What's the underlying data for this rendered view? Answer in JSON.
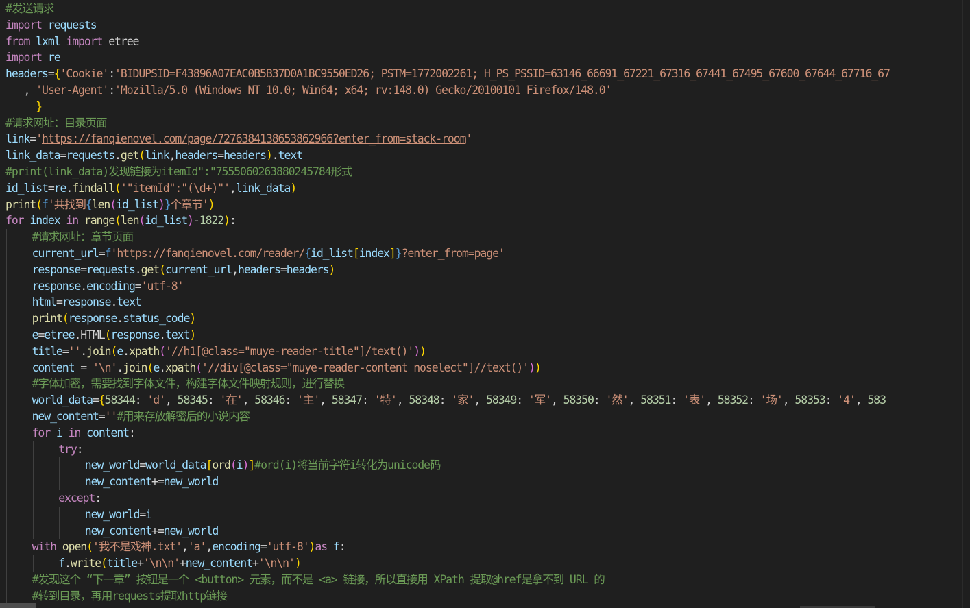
{
  "code_lines": [
    {
      "indent": 0,
      "tokens": [
        {
          "t": "#发送请求",
          "c": "c"
        }
      ]
    },
    {
      "indent": 0,
      "tokens": [
        {
          "t": "import",
          "c": "kc"
        },
        {
          "t": " "
        },
        {
          "t": "requests",
          "c": "v"
        }
      ]
    },
    {
      "indent": 0,
      "tokens": [
        {
          "t": "from",
          "c": "kc"
        },
        {
          "t": " "
        },
        {
          "t": "lxml",
          "c": "v"
        },
        {
          "t": " "
        },
        {
          "t": "import",
          "c": "kc"
        },
        {
          "t": " etree"
        }
      ]
    },
    {
      "indent": 0,
      "tokens": [
        {
          "t": "import",
          "c": "kc"
        },
        {
          "t": " "
        },
        {
          "t": "re",
          "c": "v"
        }
      ]
    },
    {
      "indent": 0,
      "tokens": [
        {
          "t": "headers",
          "c": "v"
        },
        {
          "t": "="
        },
        {
          "t": "{",
          "c": "c1"
        },
        {
          "t": "'Cookie'",
          "c": "s"
        },
        {
          "t": ":"
        },
        {
          "t": "'BIDUPSID=F43896A07EAC0B5B37D0A1BC9550ED26; PSTM=1772002261; H_PS_PSSID=63146_66691_67221_67316_67441_67495_67600_67644_67716_67",
          "c": "s"
        }
      ]
    },
    {
      "indent": 0,
      "tokens": [
        {
          "t": "   , "
        },
        {
          "t": "'User-Agent'",
          "c": "s"
        },
        {
          "t": ":"
        },
        {
          "t": "'Mozilla/5.0 (Windows NT 10.0; Win64; x64; rv:148.0) Gecko/20100101 Firefox/148.0'",
          "c": "s"
        }
      ]
    },
    {
      "indent": 0,
      "tokens": [
        {
          "t": "     "
        },
        {
          "t": "}",
          "c": "c1"
        }
      ]
    },
    {
      "indent": 0,
      "tokens": [
        {
          "t": "#请求网址：目录页面",
          "c": "c"
        }
      ]
    },
    {
      "indent": 0,
      "tokens": [
        {
          "t": "link",
          "c": "v"
        },
        {
          "t": "="
        },
        {
          "t": "'",
          "c": "s"
        },
        {
          "t": "https://fanqienovel.com/page/7276384138653862966?enter_from=stack-room",
          "c": "s u"
        },
        {
          "t": "'",
          "c": "s"
        }
      ]
    },
    {
      "indent": 0,
      "tokens": [
        {
          "t": "link_data",
          "c": "v"
        },
        {
          "t": "="
        },
        {
          "t": "requests",
          "c": "v"
        },
        {
          "t": "."
        },
        {
          "t": "get",
          "c": "f"
        },
        {
          "t": "(",
          "c": "c1"
        },
        {
          "t": "link",
          "c": "v"
        },
        {
          "t": ","
        },
        {
          "t": "headers",
          "c": "v"
        },
        {
          "t": "="
        },
        {
          "t": "headers",
          "c": "v"
        },
        {
          "t": ")",
          "c": "c1"
        },
        {
          "t": "."
        },
        {
          "t": "text",
          "c": "v"
        }
      ]
    },
    {
      "indent": 0,
      "tokens": [
        {
          "t": "#print(link_data)发现链接为itemId\":\"7555060263880245784形式",
          "c": "c"
        }
      ]
    },
    {
      "indent": 0,
      "tokens": [
        {
          "t": "id_list",
          "c": "v"
        },
        {
          "t": "="
        },
        {
          "t": "re",
          "c": "v"
        },
        {
          "t": "."
        },
        {
          "t": "findall",
          "c": "f"
        },
        {
          "t": "(",
          "c": "c1"
        },
        {
          "t": "'\"itemId\":\"(\\d+)\"'",
          "c": "s"
        },
        {
          "t": ","
        },
        {
          "t": "link_data",
          "c": "v"
        },
        {
          "t": ")",
          "c": "c1"
        }
      ]
    },
    {
      "indent": 0,
      "tokens": [
        {
          "t": "print",
          "c": "f"
        },
        {
          "t": "(",
          "c": "c1"
        },
        {
          "t": "f",
          "c": "k"
        },
        {
          "t": "'共找到",
          "c": "s"
        },
        {
          "t": "{",
          "c": "k"
        },
        {
          "t": "len",
          "c": "f"
        },
        {
          "t": "(",
          "c": "c2"
        },
        {
          "t": "id_list",
          "c": "v"
        },
        {
          "t": ")",
          "c": "c2"
        },
        {
          "t": "}",
          "c": "k"
        },
        {
          "t": "个章节'",
          "c": "s"
        },
        {
          "t": ")",
          "c": "c1"
        }
      ]
    },
    {
      "indent": 0,
      "tokens": [
        {
          "t": "for",
          "c": "kc"
        },
        {
          "t": " "
        },
        {
          "t": "index",
          "c": "v"
        },
        {
          "t": " "
        },
        {
          "t": "in",
          "c": "kc"
        },
        {
          "t": " "
        },
        {
          "t": "range",
          "c": "f"
        },
        {
          "t": "(",
          "c": "c1"
        },
        {
          "t": "len",
          "c": "f"
        },
        {
          "t": "(",
          "c": "c2"
        },
        {
          "t": "id_list",
          "c": "v"
        },
        {
          "t": ")",
          "c": "c2"
        },
        {
          "t": "-"
        },
        {
          "t": "1822",
          "c": "n"
        },
        {
          "t": ")",
          "c": "c1"
        },
        {
          "t": ":"
        }
      ]
    },
    {
      "indent": 1,
      "tokens": [
        {
          "t": "#请求网址：章节页面",
          "c": "c"
        }
      ]
    },
    {
      "indent": 1,
      "tokens": [
        {
          "t": "current_url",
          "c": "v"
        },
        {
          "t": "="
        },
        {
          "t": "f",
          "c": "k"
        },
        {
          "t": "'",
          "c": "s"
        },
        {
          "t": "https://fanqienovel.com/reader/",
          "c": "s u"
        },
        {
          "t": "{",
          "c": "k u"
        },
        {
          "t": "id_list",
          "c": "v u"
        },
        {
          "t": "[",
          "c": "c1 u"
        },
        {
          "t": "index",
          "c": "v u"
        },
        {
          "t": "]",
          "c": "c1 u"
        },
        {
          "t": "}",
          "c": "k u"
        },
        {
          "t": "?enter_from=page",
          "c": "s u"
        },
        {
          "t": "'",
          "c": "s"
        }
      ]
    },
    {
      "indent": 1,
      "tokens": [
        {
          "t": "response",
          "c": "v"
        },
        {
          "t": "="
        },
        {
          "t": "requests",
          "c": "v"
        },
        {
          "t": "."
        },
        {
          "t": "get",
          "c": "f"
        },
        {
          "t": "(",
          "c": "c1"
        },
        {
          "t": "current_url",
          "c": "v"
        },
        {
          "t": ","
        },
        {
          "t": "headers",
          "c": "v"
        },
        {
          "t": "="
        },
        {
          "t": "headers",
          "c": "v"
        },
        {
          "t": ")",
          "c": "c1"
        }
      ]
    },
    {
      "indent": 1,
      "tokens": [
        {
          "t": "response",
          "c": "v"
        },
        {
          "t": "."
        },
        {
          "t": "encoding",
          "c": "v"
        },
        {
          "t": "="
        },
        {
          "t": "'utf-8'",
          "c": "s"
        }
      ]
    },
    {
      "indent": 1,
      "tokens": [
        {
          "t": "html",
          "c": "v"
        },
        {
          "t": "="
        },
        {
          "t": "response",
          "c": "v"
        },
        {
          "t": "."
        },
        {
          "t": "text",
          "c": "v"
        }
      ]
    },
    {
      "indent": 1,
      "tokens": [
        {
          "t": "print",
          "c": "f"
        },
        {
          "t": "(",
          "c": "c1"
        },
        {
          "t": "response",
          "c": "v"
        },
        {
          "t": "."
        },
        {
          "t": "status_code",
          "c": "v"
        },
        {
          "t": ")",
          "c": "c1"
        }
      ]
    },
    {
      "indent": 1,
      "tokens": [
        {
          "t": "e",
          "c": "v"
        },
        {
          "t": "="
        },
        {
          "t": "etree",
          "c": "v"
        },
        {
          "t": "."
        },
        {
          "t": "HTML"
        },
        {
          "t": "(",
          "c": "c1"
        },
        {
          "t": "response",
          "c": "v"
        },
        {
          "t": "."
        },
        {
          "t": "text",
          "c": "v"
        },
        {
          "t": ")",
          "c": "c1"
        }
      ]
    },
    {
      "indent": 1,
      "tokens": [
        {
          "t": "title",
          "c": "v"
        },
        {
          "t": "="
        },
        {
          "t": "''",
          "c": "s"
        },
        {
          "t": "."
        },
        {
          "t": "join",
          "c": "f"
        },
        {
          "t": "(",
          "c": "c1"
        },
        {
          "t": "e",
          "c": "v"
        },
        {
          "t": "."
        },
        {
          "t": "xpath",
          "c": "f"
        },
        {
          "t": "(",
          "c": "c2"
        },
        {
          "t": "'//h1[@class=\"muye-reader-title\"]/text()'",
          "c": "s"
        },
        {
          "t": ")",
          "c": "c2"
        },
        {
          "t": ")",
          "c": "c1"
        }
      ]
    },
    {
      "indent": 1,
      "tokens": [
        {
          "t": "content",
          "c": "v"
        },
        {
          "t": " = "
        },
        {
          "t": "'\\n'",
          "c": "s"
        },
        {
          "t": "."
        },
        {
          "t": "join",
          "c": "f"
        },
        {
          "t": "(",
          "c": "c1"
        },
        {
          "t": "e",
          "c": "v"
        },
        {
          "t": "."
        },
        {
          "t": "xpath",
          "c": "f"
        },
        {
          "t": "(",
          "c": "c2"
        },
        {
          "t": "'//div[@class=\"muye-reader-content noselect\"]//text()'",
          "c": "s"
        },
        {
          "t": ")",
          "c": "c2"
        },
        {
          "t": ")",
          "c": "c1"
        }
      ]
    },
    {
      "indent": 1,
      "tokens": [
        {
          "t": "#字体加密，需要找到字体文件，构建字体文件映射规则，进行替换",
          "c": "c"
        }
      ]
    },
    {
      "indent": 1,
      "tokens": [
        {
          "t": "world_data",
          "c": "v"
        },
        {
          "t": "="
        },
        {
          "t": "{",
          "c": "c1"
        },
        {
          "t": "58344",
          "c": "n"
        },
        {
          "t": ": "
        },
        {
          "t": "'d'",
          "c": "s"
        },
        {
          "t": ", "
        },
        {
          "t": "58345",
          "c": "n"
        },
        {
          "t": ": "
        },
        {
          "t": "'在'",
          "c": "s"
        },
        {
          "t": ", "
        },
        {
          "t": "58346",
          "c": "n"
        },
        {
          "t": ": "
        },
        {
          "t": "'主'",
          "c": "s"
        },
        {
          "t": ", "
        },
        {
          "t": "58347",
          "c": "n"
        },
        {
          "t": ": "
        },
        {
          "t": "'特'",
          "c": "s"
        },
        {
          "t": ", "
        },
        {
          "t": "58348",
          "c": "n"
        },
        {
          "t": ": "
        },
        {
          "t": "'家'",
          "c": "s"
        },
        {
          "t": ", "
        },
        {
          "t": "58349",
          "c": "n"
        },
        {
          "t": ": "
        },
        {
          "t": "'军'",
          "c": "s"
        },
        {
          "t": ", "
        },
        {
          "t": "58350",
          "c": "n"
        },
        {
          "t": ": "
        },
        {
          "t": "'然'",
          "c": "s"
        },
        {
          "t": ", "
        },
        {
          "t": "58351",
          "c": "n"
        },
        {
          "t": ": "
        },
        {
          "t": "'表'",
          "c": "s"
        },
        {
          "t": ", "
        },
        {
          "t": "58352",
          "c": "n"
        },
        {
          "t": ": "
        },
        {
          "t": "'场'",
          "c": "s"
        },
        {
          "t": ", "
        },
        {
          "t": "58353",
          "c": "n"
        },
        {
          "t": ": "
        },
        {
          "t": "'4'",
          "c": "s"
        },
        {
          "t": ", "
        },
        {
          "t": "583",
          "c": "n"
        }
      ]
    },
    {
      "indent": 1,
      "tokens": [
        {
          "t": "new_content",
          "c": "v"
        },
        {
          "t": "="
        },
        {
          "t": "''",
          "c": "s"
        },
        {
          "t": "#用来存放解密后的小说内容",
          "c": "c"
        }
      ]
    },
    {
      "indent": 1,
      "tokens": [
        {
          "t": "for",
          "c": "kc"
        },
        {
          "t": " "
        },
        {
          "t": "i",
          "c": "v"
        },
        {
          "t": " "
        },
        {
          "t": "in",
          "c": "kc"
        },
        {
          "t": " "
        },
        {
          "t": "content",
          "c": "v"
        },
        {
          "t": ":"
        }
      ]
    },
    {
      "indent": 2,
      "tokens": [
        {
          "t": "try",
          "c": "kc"
        },
        {
          "t": ":"
        }
      ]
    },
    {
      "indent": 3,
      "tokens": [
        {
          "t": "new_world",
          "c": "v"
        },
        {
          "t": "="
        },
        {
          "t": "world_data",
          "c": "v"
        },
        {
          "t": "[",
          "c": "c1"
        },
        {
          "t": "ord",
          "c": "f"
        },
        {
          "t": "(",
          "c": "c2"
        },
        {
          "t": "i",
          "c": "v"
        },
        {
          "t": ")",
          "c": "c2"
        },
        {
          "t": "]",
          "c": "c1"
        },
        {
          "t": "#ord(i)将当前字符i转化为unicode码",
          "c": "c"
        }
      ]
    },
    {
      "indent": 3,
      "tokens": [
        {
          "t": "new_content",
          "c": "v"
        },
        {
          "t": "+="
        },
        {
          "t": "new_world",
          "c": "v"
        }
      ]
    },
    {
      "indent": 2,
      "tokens": [
        {
          "t": "except",
          "c": "kc"
        },
        {
          "t": ":"
        }
      ]
    },
    {
      "indent": 3,
      "tokens": [
        {
          "t": "new_world",
          "c": "v"
        },
        {
          "t": "="
        },
        {
          "t": "i",
          "c": "v"
        }
      ]
    },
    {
      "indent": 3,
      "tokens": [
        {
          "t": "new_content",
          "c": "v"
        },
        {
          "t": "+="
        },
        {
          "t": "new_world",
          "c": "v"
        }
      ]
    },
    {
      "indent": 1,
      "tokens": [
        {
          "t": "with",
          "c": "kc"
        },
        {
          "t": " "
        },
        {
          "t": "open",
          "c": "f"
        },
        {
          "t": "(",
          "c": "c1"
        },
        {
          "t": "'我不是戏神.txt'",
          "c": "s"
        },
        {
          "t": ","
        },
        {
          "t": "'a'",
          "c": "s"
        },
        {
          "t": ","
        },
        {
          "t": "encoding",
          "c": "v"
        },
        {
          "t": "="
        },
        {
          "t": "'utf-8'",
          "c": "s"
        },
        {
          "t": ")",
          "c": "c1"
        },
        {
          "t": "as",
          "c": "kc"
        },
        {
          "t": " "
        },
        {
          "t": "f",
          "c": "v"
        },
        {
          "t": ":"
        }
      ]
    },
    {
      "indent": 2,
      "tokens": [
        {
          "t": "f",
          "c": "v"
        },
        {
          "t": "."
        },
        {
          "t": "write",
          "c": "f"
        },
        {
          "t": "(",
          "c": "c1"
        },
        {
          "t": "title",
          "c": "v"
        },
        {
          "t": "+"
        },
        {
          "t": "'\\n\\n'",
          "c": "s"
        },
        {
          "t": "+"
        },
        {
          "t": "new_content",
          "c": "v"
        },
        {
          "t": "+"
        },
        {
          "t": "'\\n\\n'",
          "c": "s"
        },
        {
          "t": ")",
          "c": "c1"
        }
      ]
    },
    {
      "indent": 1,
      "tokens": [
        {
          "t": "#发现这个 “下一章” 按钮是一个 <button> 元素，而不是 <a> 链接，所以直接用 XPath 提取@href是拿不到 URL 的",
          "c": "c"
        }
      ]
    },
    {
      "indent": 1,
      "tokens": [
        {
          "t": "#转到目录，再用requests提取http链接",
          "c": "c"
        }
      ]
    }
  ]
}
